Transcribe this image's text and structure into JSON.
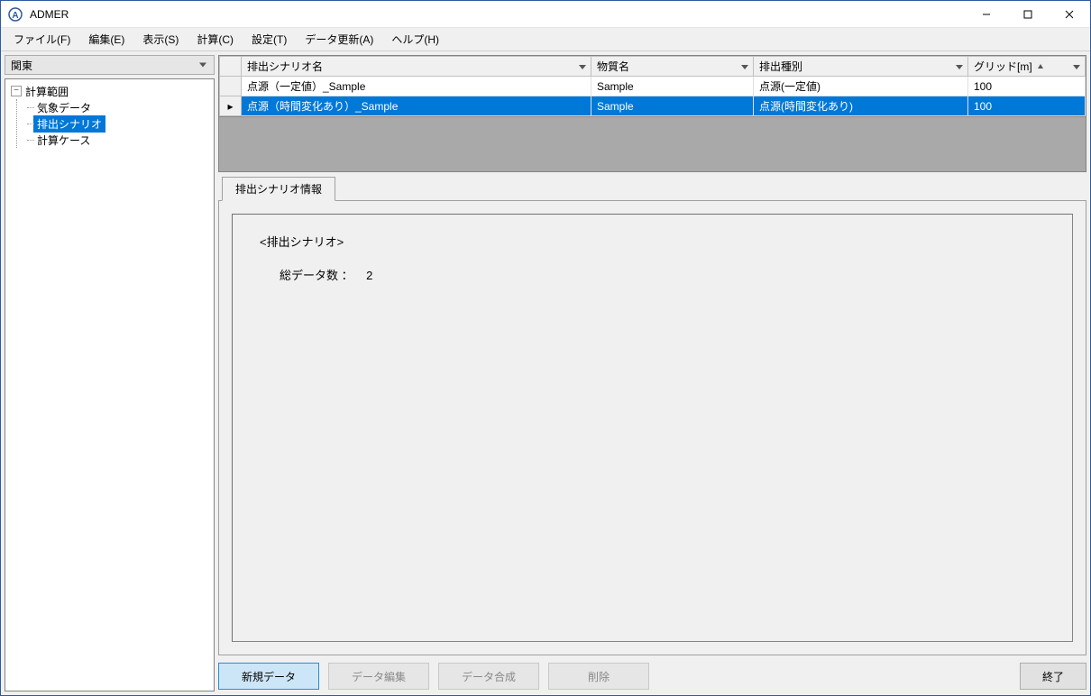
{
  "window": {
    "title": "ADMER"
  },
  "menu": {
    "file": "ファイル(F)",
    "edit": "編集(E)",
    "view": "表示(S)",
    "calc": "計算(C)",
    "settings": "設定(T)",
    "data_update": "データ更新(A)",
    "help": "ヘルプ(H)"
  },
  "region_select": {
    "value": "関東"
  },
  "tree": {
    "root": "計算範囲",
    "items": [
      "気象データ",
      "排出シナリオ",
      "計算ケース"
    ],
    "selected_index": 1
  },
  "grid": {
    "columns": {
      "scenario_name": "排出シナリオ名",
      "substance": "物質名",
      "emission_type": "排出種別",
      "grid_m": "グリッド[m]"
    },
    "rows": [
      {
        "scenario_name": "点源（一定値）_Sample",
        "substance": "Sample",
        "emission_type": "点源(一定値)",
        "grid_m": "100"
      },
      {
        "scenario_name": "点源（時間変化あり）_Sample",
        "substance": "Sample",
        "emission_type": "点源(時間変化あり)",
        "grid_m": "100"
      }
    ],
    "selected_row": 1
  },
  "info": {
    "tab_label": "排出シナリオ情報",
    "section_title": "<排出シナリオ>",
    "count_label": "総データ数 ：",
    "count_value": "2"
  },
  "buttons": {
    "new_data": "新規データ",
    "edit_data": "データ編集",
    "merge_data": "データ合成",
    "delete": "削除",
    "exit": "終了"
  }
}
